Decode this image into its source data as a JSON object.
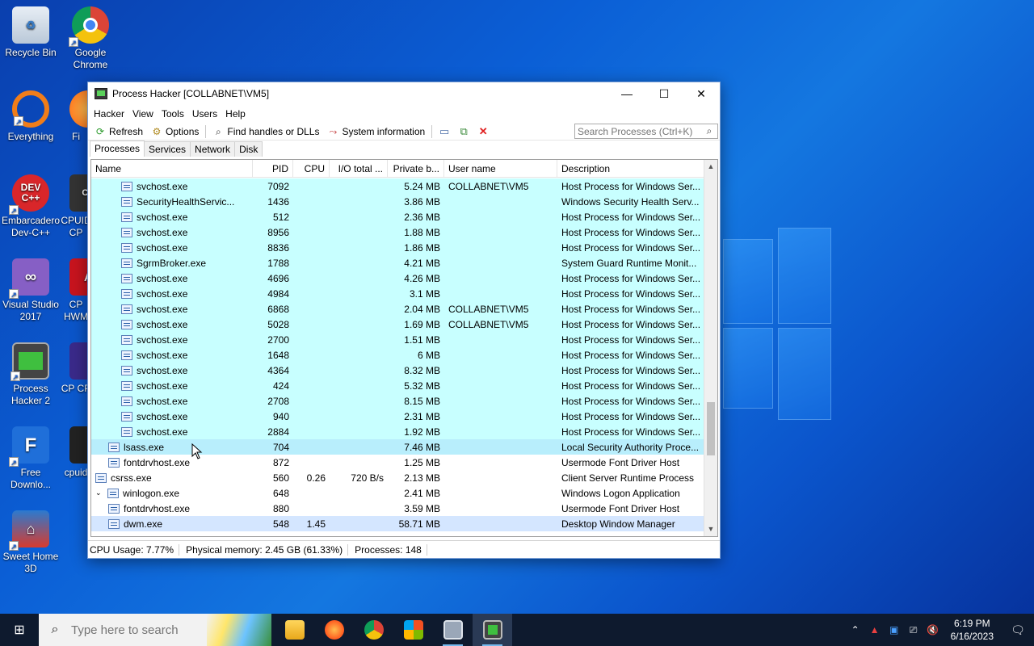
{
  "desktop": {
    "icons": [
      {
        "label": "Recycle Bin",
        "icon": "recycle-bin-icon"
      },
      {
        "label": "Google Chrome",
        "icon": "chrome-icon"
      },
      {
        "label": "Everything",
        "icon": "everything-icon"
      },
      {
        "label": "Fi",
        "icon": "firefox-icon"
      },
      {
        "label": "Embarcadero Dev-C++",
        "icon": "devcpp-icon"
      },
      {
        "label": "CPUID CP",
        "icon": "cpuid-icon"
      },
      {
        "label": "Visual Studio 2017",
        "icon": "visual-studio-icon"
      },
      {
        "label": "CP HWM",
        "icon": "hwmonitor-icon"
      },
      {
        "label": "Process Hacker 2",
        "icon": "process-hacker-icon"
      },
      {
        "label": "CP CP",
        "icon": "cpuz-icon"
      },
      {
        "label": "Free Downlo...",
        "icon": "free-download-manager-icon"
      },
      {
        "label": "cpuid",
        "icon": "cpuid-app-icon"
      },
      {
        "label": "Sweet Home 3D",
        "icon": "sweet-home-3d-icon"
      }
    ]
  },
  "window": {
    "title": "Process Hacker [COLLABNET\\VM5]",
    "menus": [
      "Hacker",
      "View",
      "Tools",
      "Users",
      "Help"
    ],
    "toolbar": {
      "refresh": "Refresh",
      "options": "Options",
      "find_handles": "Find handles or DLLs",
      "system_info": "System information"
    },
    "search_placeholder": "Search Processes (Ctrl+K)",
    "tabs": [
      "Processes",
      "Services",
      "Network",
      "Disk"
    ],
    "columns": [
      "Name",
      "PID",
      "CPU",
      "I/O total ...",
      "Private b...",
      "User name",
      "Description"
    ],
    "status": {
      "cpu": "CPU Usage: 7.77%",
      "memory": "Physical memory: 2.45 GB (61.33%)",
      "processes": "Processes: 148"
    }
  },
  "processes": [
    {
      "name": "svchost.exe",
      "pid": "7092",
      "cpu": "",
      "io": "",
      "priv": "5.24 MB",
      "user": "COLLABNET\\VM5",
      "desc": "Host Process for Windows Ser...",
      "indent": 3,
      "color": "#c8ffff"
    },
    {
      "name": "SecurityHealthServic...",
      "pid": "1436",
      "cpu": "",
      "io": "",
      "priv": "3.86 MB",
      "user": "",
      "desc": "Windows Security Health Serv...",
      "indent": 3,
      "color": "#c8ffff"
    },
    {
      "name": "svchost.exe",
      "pid": "512",
      "cpu": "",
      "io": "",
      "priv": "2.36 MB",
      "user": "",
      "desc": "Host Process for Windows Ser...",
      "indent": 3,
      "color": "#c8ffff"
    },
    {
      "name": "svchost.exe",
      "pid": "8956",
      "cpu": "",
      "io": "",
      "priv": "1.88 MB",
      "user": "",
      "desc": "Host Process for Windows Ser...",
      "indent": 3,
      "color": "#c8ffff"
    },
    {
      "name": "svchost.exe",
      "pid": "8836",
      "cpu": "",
      "io": "",
      "priv": "1.86 MB",
      "user": "",
      "desc": "Host Process for Windows Ser...",
      "indent": 3,
      "color": "#c8ffff"
    },
    {
      "name": "SgrmBroker.exe",
      "pid": "1788",
      "cpu": "",
      "io": "",
      "priv": "4.21 MB",
      "user": "",
      "desc": "System Guard Runtime Monit...",
      "indent": 3,
      "color": "#c8ffff"
    },
    {
      "name": "svchost.exe",
      "pid": "4696",
      "cpu": "",
      "io": "",
      "priv": "4.26 MB",
      "user": "",
      "desc": "Host Process for Windows Ser...",
      "indent": 3,
      "color": "#c8ffff"
    },
    {
      "name": "svchost.exe",
      "pid": "4984",
      "cpu": "",
      "io": "",
      "priv": "3.1 MB",
      "user": "",
      "desc": "Host Process for Windows Ser...",
      "indent": 3,
      "color": "#c8ffff"
    },
    {
      "name": "svchost.exe",
      "pid": "6868",
      "cpu": "",
      "io": "",
      "priv": "2.04 MB",
      "user": "COLLABNET\\VM5",
      "desc": "Host Process for Windows Ser...",
      "indent": 3,
      "color": "#c8ffff"
    },
    {
      "name": "svchost.exe",
      "pid": "5028",
      "cpu": "",
      "io": "",
      "priv": "1.69 MB",
      "user": "COLLABNET\\VM5",
      "desc": "Host Process for Windows Ser...",
      "indent": 3,
      "color": "#c8ffff"
    },
    {
      "name": "svchost.exe",
      "pid": "2700",
      "cpu": "",
      "io": "",
      "priv": "1.51 MB",
      "user": "",
      "desc": "Host Process for Windows Ser...",
      "indent": 3,
      "color": "#c8ffff"
    },
    {
      "name": "svchost.exe",
      "pid": "1648",
      "cpu": "",
      "io": "",
      "priv": "6 MB",
      "user": "",
      "desc": "Host Process for Windows Ser...",
      "indent": 3,
      "color": "#c8ffff"
    },
    {
      "name": "svchost.exe",
      "pid": "4364",
      "cpu": "",
      "io": "",
      "priv": "8.32 MB",
      "user": "",
      "desc": "Host Process for Windows Ser...",
      "indent": 3,
      "color": "#c8ffff"
    },
    {
      "name": "svchost.exe",
      "pid": "424",
      "cpu": "",
      "io": "",
      "priv": "5.32 MB",
      "user": "",
      "desc": "Host Process for Windows Ser...",
      "indent": 3,
      "color": "#c8ffff"
    },
    {
      "name": "svchost.exe",
      "pid": "2708",
      "cpu": "",
      "io": "",
      "priv": "8.15 MB",
      "user": "",
      "desc": "Host Process for Windows Ser...",
      "indent": 3,
      "color": "#c8ffff"
    },
    {
      "name": "svchost.exe",
      "pid": "940",
      "cpu": "",
      "io": "",
      "priv": "2.31 MB",
      "user": "",
      "desc": "Host Process for Windows Ser...",
      "indent": 3,
      "color": "#c8ffff"
    },
    {
      "name": "svchost.exe",
      "pid": "2884",
      "cpu": "",
      "io": "",
      "priv": "1.92 MB",
      "user": "",
      "desc": "Host Process for Windows Ser...",
      "indent": 3,
      "color": "#c8ffff"
    },
    {
      "name": "lsass.exe",
      "pid": "704",
      "cpu": "",
      "io": "",
      "priv": "7.46 MB",
      "user": "",
      "desc": "Local Security Authority Proce...",
      "indent": 2,
      "color": "#b8eefc"
    },
    {
      "name": "fontdrvhost.exe",
      "pid": "872",
      "cpu": "",
      "io": "",
      "priv": "1.25 MB",
      "user": "",
      "desc": "Usermode Font Driver Host",
      "indent": 2,
      "color": "#ffffff"
    },
    {
      "name": "csrss.exe",
      "pid": "560",
      "cpu": "0.26",
      "io": "720 B/s",
      "priv": "2.13 MB",
      "user": "",
      "desc": "Client Server Runtime Process",
      "indent": 1,
      "color": "#ffffff"
    },
    {
      "name": "winlogon.exe",
      "pid": "648",
      "cpu": "",
      "io": "",
      "priv": "2.41 MB",
      "user": "",
      "desc": "Windows Logon Application",
      "indent": 1,
      "color": "#ffffff",
      "expanded": true
    },
    {
      "name": "fontdrvhost.exe",
      "pid": "880",
      "cpu": "",
      "io": "",
      "priv": "3.59 MB",
      "user": "",
      "desc": "Usermode Font Driver Host",
      "indent": 2,
      "color": "#ffffff"
    },
    {
      "name": "dwm.exe",
      "pid": "548",
      "cpu": "1.45",
      "io": "",
      "priv": "58.71 MB",
      "user": "",
      "desc": "Desktop Window Manager",
      "indent": 2,
      "color": "#d4e6ff"
    }
  ],
  "taskbar": {
    "search_placeholder": "Type here to search",
    "time": "6:19 PM",
    "date": "6/16/2023"
  }
}
